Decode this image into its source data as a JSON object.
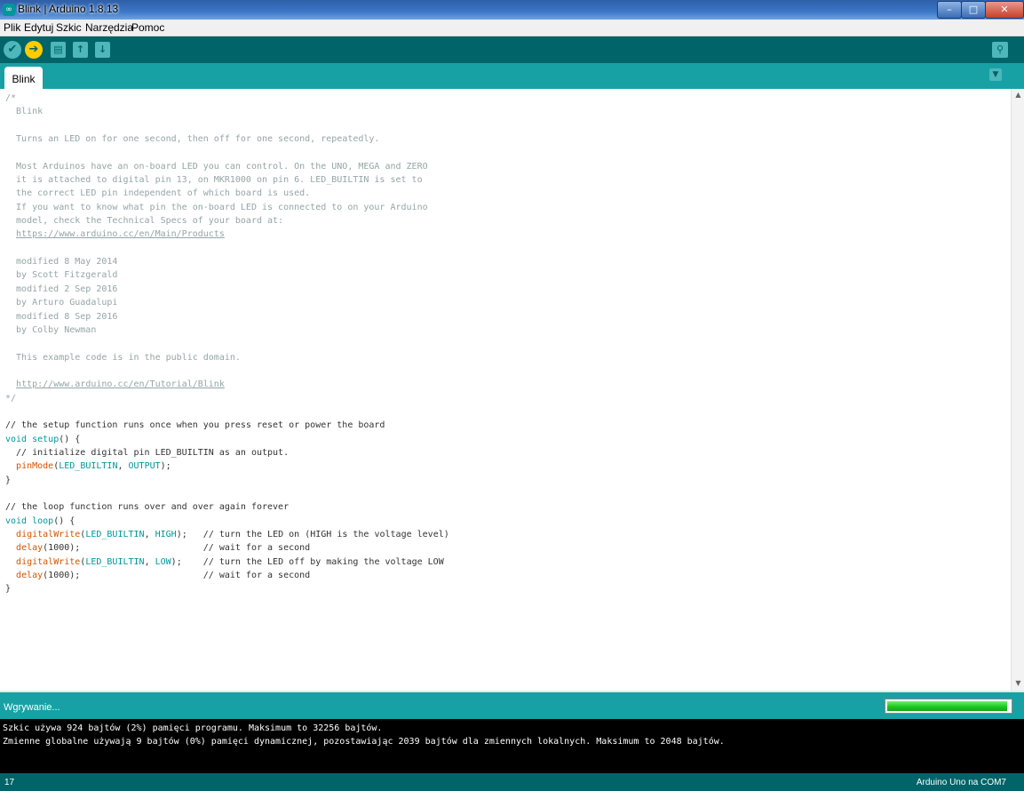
{
  "window": {
    "title": "Blink | Arduino 1.8.13",
    "icon": "arduino-logo-icon",
    "controls": {
      "minimize": "–",
      "maximize": "□",
      "close": "✕"
    }
  },
  "menu": [
    "Plik",
    "Edytuj",
    "Szkic",
    "Narzędzia",
    "Pomoc"
  ],
  "toolbar": {
    "verify_icon": "✔",
    "upload_icon": "➔",
    "new_icon": "▤",
    "open_icon": "↑",
    "save_icon": "↓",
    "serial_monitor_icon": "⚲"
  },
  "tabs": [
    {
      "label": "Blink",
      "active": true
    }
  ],
  "tab_menu_icon": "▼",
  "editor": {
    "lines": [
      [
        [
          "/*",
          "comment"
        ]
      ],
      [
        [
          "  Blink",
          "comment"
        ]
      ],
      [
        [
          "",
          "plain"
        ]
      ],
      [
        [
          "  Turns an LED on for one second, then off for one second, repeatedly.",
          "comment"
        ]
      ],
      [
        [
          "",
          "plain"
        ]
      ],
      [
        [
          "  Most Arduinos have an on-board LED you can control. On the UNO, MEGA and ZERO",
          "comment"
        ]
      ],
      [
        [
          "  it is attached to digital pin 13, on MKR1000 on pin 6. LED_BUILTIN is set to",
          "comment"
        ]
      ],
      [
        [
          "  the correct LED pin independent of which board is used.",
          "comment"
        ]
      ],
      [
        [
          "  If you want to know what pin the on-board LED is connected to on your Arduino",
          "comment"
        ]
      ],
      [
        [
          "  model, check the Technical Specs of your board at:",
          "comment"
        ]
      ],
      [
        [
          "  ",
          "comment"
        ],
        [
          "https://www.arduino.cc/en/Main/Products",
          "comment link"
        ]
      ],
      [
        [
          "",
          "plain"
        ]
      ],
      [
        [
          "  modified 8 May 2014",
          "comment"
        ]
      ],
      [
        [
          "  by Scott Fitzgerald",
          "comment"
        ]
      ],
      [
        [
          "  modified 2 Sep 2016",
          "comment"
        ]
      ],
      [
        [
          "  by Arturo Guadalupi",
          "comment"
        ]
      ],
      [
        [
          "  modified 8 Sep 2016",
          "comment"
        ]
      ],
      [
        [
          "  by Colby Newman",
          "comment"
        ]
      ],
      [
        [
          "",
          "plain"
        ]
      ],
      [
        [
          "  This example code is in the public domain.",
          "comment"
        ]
      ],
      [
        [
          "",
          "plain"
        ]
      ],
      [
        [
          "  ",
          "comment"
        ],
        [
          "http://www.arduino.cc/en/Tutorial/Blink",
          "comment link"
        ]
      ],
      [
        [
          "*/",
          "comment"
        ]
      ],
      [
        [
          "",
          "plain"
        ]
      ],
      [
        [
          "// the setup function runs once when you press reset or power the board",
          "plain"
        ]
      ],
      [
        [
          "void",
          "keyword"
        ],
        [
          " ",
          "plain"
        ],
        [
          "setup",
          "keyword"
        ],
        [
          "() {",
          "plain"
        ]
      ],
      [
        [
          "  // initialize digital pin LED_BUILTIN as an output.",
          "plain"
        ]
      ],
      [
        [
          "  ",
          "plain"
        ],
        [
          "pinMode",
          "func"
        ],
        [
          "(",
          "plain"
        ],
        [
          "LED_BUILTIN",
          "const"
        ],
        [
          ", ",
          "plain"
        ],
        [
          "OUTPUT",
          "const"
        ],
        [
          ");",
          "plain"
        ]
      ],
      [
        [
          "}",
          "plain"
        ]
      ],
      [
        [
          "",
          "plain"
        ]
      ],
      [
        [
          "// the loop function runs over and over again forever",
          "plain"
        ]
      ],
      [
        [
          "void",
          "keyword"
        ],
        [
          " ",
          "plain"
        ],
        [
          "loop",
          "keyword"
        ],
        [
          "() {",
          "plain"
        ]
      ],
      [
        [
          "  ",
          "plain"
        ],
        [
          "digitalWrite",
          "func"
        ],
        [
          "(",
          "plain"
        ],
        [
          "LED_BUILTIN",
          "const"
        ],
        [
          ", ",
          "plain"
        ],
        [
          "HIGH",
          "const"
        ],
        [
          ");   // turn the LED on (HIGH is the voltage level)",
          "plain"
        ]
      ],
      [
        [
          "  ",
          "plain"
        ],
        [
          "delay",
          "func"
        ],
        [
          "(1000);                       // wait for a second",
          "plain"
        ]
      ],
      [
        [
          "  ",
          "plain"
        ],
        [
          "digitalWrite",
          "func"
        ],
        [
          "(",
          "plain"
        ],
        [
          "LED_BUILTIN",
          "const"
        ],
        [
          ", ",
          "plain"
        ],
        [
          "LOW",
          "const"
        ],
        [
          ");    // turn the LED off by making the voltage LOW",
          "plain"
        ]
      ],
      [
        [
          "  ",
          "plain"
        ],
        [
          "delay",
          "func"
        ],
        [
          "(1000);                       // wait for a second",
          "plain"
        ]
      ],
      [
        [
          "}",
          "plain"
        ]
      ]
    ]
  },
  "scrollbar": {
    "up": "▲",
    "down": "▼"
  },
  "status": {
    "text": "Wgrywanie...",
    "progress": 0.98
  },
  "console": [
    "Szkic używa 924 bajtów (2%) pamięci programu. Maksimum to 32256 bajtów.",
    "Zmienne globalne używają 9 bajtów (0%) pamięci dynamicznej, pozostawiając 2039 bajtów dla zmiennych lokalnych. Maksimum to 2048 bajtów."
  ],
  "footer": {
    "line_number": "17",
    "board": "Arduino Uno na COM7"
  },
  "colors": {
    "toolbar": "#006468",
    "tabbar": "#17a1a5",
    "comment": "#95a5a6",
    "keyword": "#00979c",
    "function": "#d35400"
  }
}
